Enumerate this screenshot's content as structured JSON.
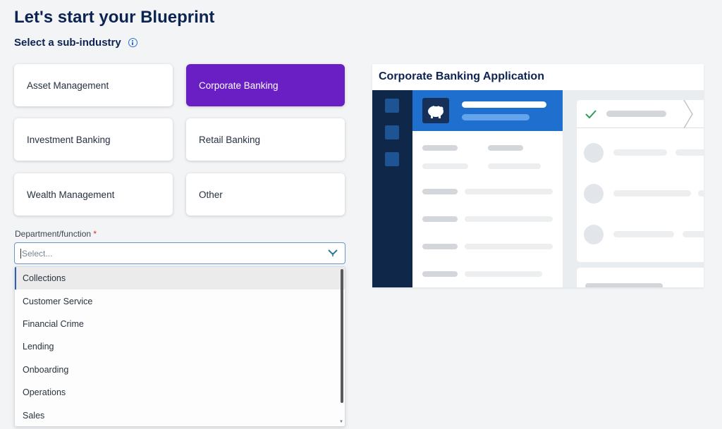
{
  "page": {
    "title": "Let's start your Blueprint",
    "section_label": "Select a sub-industry"
  },
  "sub_industries": [
    {
      "label": "Asset Management",
      "selected": false
    },
    {
      "label": "Corporate Banking",
      "selected": true
    },
    {
      "label": "Investment Banking",
      "selected": false
    },
    {
      "label": "Retail Banking",
      "selected": false
    },
    {
      "label": "Wealth Management",
      "selected": false
    },
    {
      "label": "Other",
      "selected": false
    }
  ],
  "department": {
    "label": "Department/function",
    "required_mark": "*",
    "placeholder": "Select...",
    "options": [
      "Collections",
      "Customer Service",
      "Financial Crime",
      "Lending",
      "Onboarding",
      "Operations",
      "Sales"
    ],
    "highlighted_option": "Collections"
  },
  "preview": {
    "title": "Corporate Banking Application"
  },
  "colors": {
    "accent_selected": "#6a1fc4",
    "title_navy": "#0d2452",
    "preview_sidebar": "#0f2748",
    "preview_header": "#1f6fcf"
  },
  "icons": {
    "info": "info-circle-icon",
    "select_chevron": "chevron-down-icon",
    "check": "check-icon",
    "piggy_bank": "piggy-bank-icon"
  }
}
